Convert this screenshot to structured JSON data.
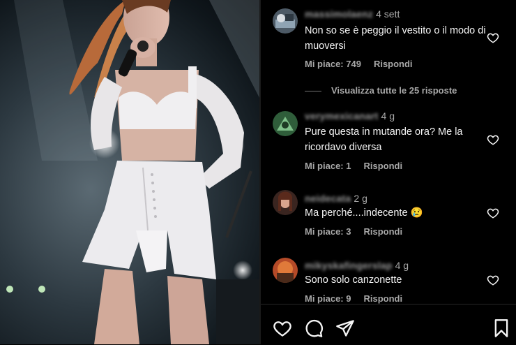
{
  "photo": {
    "description_icon": "concert-photo"
  },
  "comments": [
    {
      "username": "massimolaenz",
      "time": "4 sett",
      "text": "Non so se è peggio il vestito o il modo di muoversi",
      "likes": "Mi piace: 749",
      "reply": "Rispondi",
      "avatar_color": "#4d5a66"
    },
    {
      "username": "verymexicanart",
      "time": "4 g",
      "text": "Pure questa in mutande ora? Me la ricordavo diversa",
      "likes": "Mi piace: 1",
      "reply": "Rispondi",
      "avatar_color": "#2f5d3a"
    },
    {
      "username": "neidecata",
      "time": "2 g",
      "text": "Ma perché....indecente 😢",
      "likes": "Mi piace: 3",
      "reply": "Rispondi",
      "avatar_color": "#3a2520"
    },
    {
      "username": "mikyskafingerslap",
      "time": "4 g",
      "text": "Sono solo canzonette",
      "likes": "Mi piace: 9",
      "reply": "Rispondi",
      "avatar_color": "#b44a28"
    }
  ],
  "view_replies": "Visualizza tutte le 25 risposte",
  "actions": [
    "heart-icon",
    "comment-icon",
    "share-icon",
    "bookmark-icon"
  ],
  "colors": {
    "background": "#000000",
    "text": "#f5f5f5",
    "muted": "#a8a8a8"
  }
}
